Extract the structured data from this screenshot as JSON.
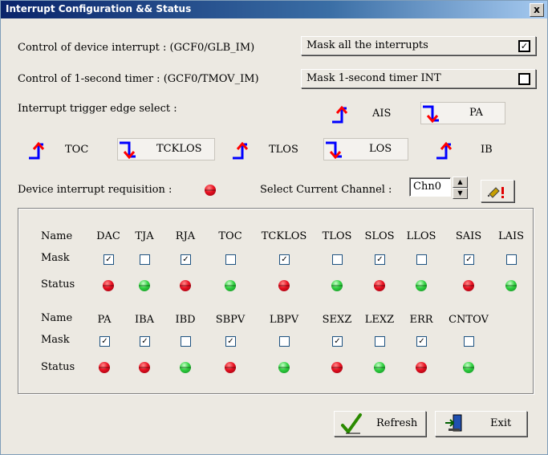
{
  "window": {
    "title": "Interrupt Configuration && Status",
    "close_label": "x"
  },
  "controls": {
    "device_interrupt_label": "Control of device interrupt  : (GCF0/GLB_IM)",
    "mask_all_label": "Mask all the interrupts",
    "mask_all_checked": true,
    "timer_label": "Control of 1-second timer : (GCF0/TMOV_IM)",
    "mask_timer_label": "Mask 1-second timer INT",
    "mask_timer_checked": false,
    "edge_select_label": "Interrupt trigger edge select :"
  },
  "edges": [
    {
      "name": "AIS",
      "edge": "rising"
    },
    {
      "name": "PA",
      "edge": "falling"
    },
    {
      "name": "TOC",
      "edge": "rising"
    },
    {
      "name": "TCKLOS",
      "edge": "falling"
    },
    {
      "name": "TLOS",
      "edge": "rising"
    },
    {
      "name": "LOS",
      "edge": "falling"
    },
    {
      "name": "IB",
      "edge": "rising"
    }
  ],
  "requisition": {
    "label": "Device interrupt requisition :",
    "status": "red"
  },
  "channel": {
    "label": "Select Current Channel :",
    "value": "Chn0"
  },
  "table": {
    "row_labels": {
      "name": "Name",
      "mask": "Mask",
      "status": "Status"
    },
    "group1": [
      {
        "name": "DAC",
        "mask": true,
        "status": "red"
      },
      {
        "name": "TJA",
        "mask": false,
        "status": "green"
      },
      {
        "name": "RJA",
        "mask": true,
        "status": "red"
      },
      {
        "name": "TOC",
        "mask": false,
        "status": "green"
      },
      {
        "name": "TCKLOS",
        "mask": true,
        "status": "red"
      },
      {
        "name": "TLOS",
        "mask": false,
        "status": "green"
      },
      {
        "name": "SLOS",
        "mask": true,
        "status": "red"
      },
      {
        "name": "LLOS",
        "mask": false,
        "status": "green"
      },
      {
        "name": "SAIS",
        "mask": true,
        "status": "red"
      },
      {
        "name": "LAIS",
        "mask": false,
        "status": "green"
      }
    ],
    "group2": [
      {
        "name": "PA",
        "mask": true,
        "status": "red"
      },
      {
        "name": "IBA",
        "mask": true,
        "status": "red"
      },
      {
        "name": "IBD",
        "mask": false,
        "status": "green"
      },
      {
        "name": "SBPV",
        "mask": true,
        "status": "red"
      },
      {
        "name": "LBPV",
        "mask": false,
        "status": "green"
      },
      {
        "name": "SEXZ",
        "mask": true,
        "status": "red"
      },
      {
        "name": "LEXZ",
        "mask": false,
        "status": "green"
      },
      {
        "name": "ERR",
        "mask": true,
        "status": "red"
      },
      {
        "name": "CNTOV",
        "mask": false,
        "status": "green"
      }
    ]
  },
  "buttons": {
    "refresh": "Refresh",
    "exit": "Exit"
  },
  "colors": {
    "rising_arrow": "#0000ff",
    "rising_arrow_head": "#ff0000",
    "falling_arrow": "#0000ff",
    "falling_arrow_head": "#ff0000"
  }
}
